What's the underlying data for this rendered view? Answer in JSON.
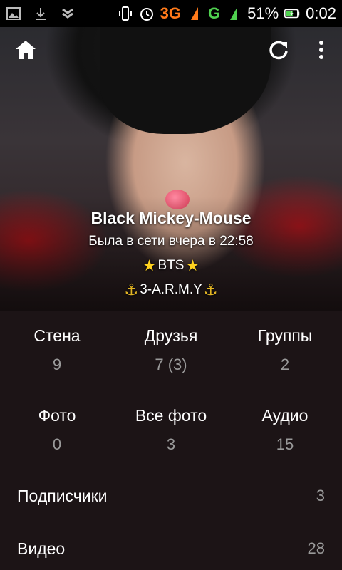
{
  "status_bar": {
    "network_3g": "3G",
    "network_g": "G",
    "battery": "51%",
    "time": "0:02"
  },
  "header": {
    "home_icon": "home-icon",
    "refresh_icon": "refresh-icon",
    "menu_icon": "more-vert-icon"
  },
  "profile": {
    "name": "Black Mickey-Mouse",
    "status": "Была в сети вчера в 22:58",
    "line1_text": "BTS",
    "line2_text": "3-A.R.M.Y"
  },
  "stats": [
    {
      "label": "Стена",
      "value": "9"
    },
    {
      "label": "Друзья",
      "value": "7 (3)"
    },
    {
      "label": "Группы",
      "value": "2"
    },
    {
      "label": "Фото",
      "value": "0"
    },
    {
      "label": "Все фото",
      "value": "3"
    },
    {
      "label": "Аудио",
      "value": "15"
    }
  ],
  "rows": [
    {
      "label": "Подписчики",
      "value": "3"
    },
    {
      "label": "Видео",
      "value": "28"
    }
  ]
}
